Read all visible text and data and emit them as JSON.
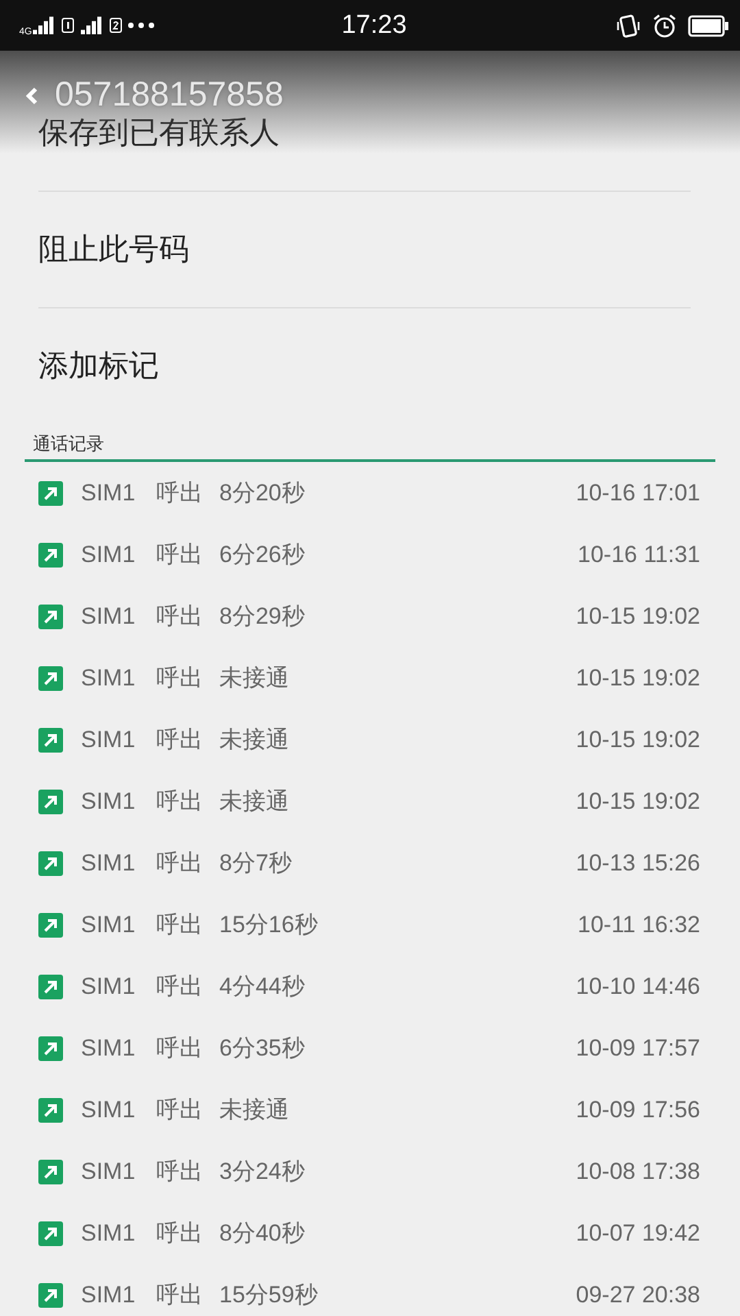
{
  "status_bar": {
    "network": "4G",
    "time": "17:23"
  },
  "header": {
    "title": "057188157858"
  },
  "actions": [
    "保存到已有联系人",
    "阻止此号码",
    "添加标记"
  ],
  "call_log": {
    "title": "通话记录",
    "rows": [
      {
        "sim": "SIM1",
        "direction": "呼出",
        "duration": "8分20秒",
        "time": "10-16 17:01"
      },
      {
        "sim": "SIM1",
        "direction": "呼出",
        "duration": "6分26秒",
        "time": "10-16 11:31"
      },
      {
        "sim": "SIM1",
        "direction": "呼出",
        "duration": "8分29秒",
        "time": "10-15 19:02"
      },
      {
        "sim": "SIM1",
        "direction": "呼出",
        "duration": "未接通",
        "time": "10-15 19:02"
      },
      {
        "sim": "SIM1",
        "direction": "呼出",
        "duration": "未接通",
        "time": "10-15 19:02"
      },
      {
        "sim": "SIM1",
        "direction": "呼出",
        "duration": "未接通",
        "time": "10-15 19:02"
      },
      {
        "sim": "SIM1",
        "direction": "呼出",
        "duration": "8分7秒",
        "time": "10-13 15:26"
      },
      {
        "sim": "SIM1",
        "direction": "呼出",
        "duration": "15分16秒",
        "time": "10-11 16:32"
      },
      {
        "sim": "SIM1",
        "direction": "呼出",
        "duration": "4分44秒",
        "time": "10-10 14:46"
      },
      {
        "sim": "SIM1",
        "direction": "呼出",
        "duration": "6分35秒",
        "time": "10-09 17:57"
      },
      {
        "sim": "SIM1",
        "direction": "呼出",
        "duration": "未接通",
        "time": "10-09 17:56"
      },
      {
        "sim": "SIM1",
        "direction": "呼出",
        "duration": "3分24秒",
        "time": "10-08 17:38"
      },
      {
        "sim": "SIM1",
        "direction": "呼出",
        "duration": "8分40秒",
        "time": "10-07 19:42"
      },
      {
        "sim": "SIM1",
        "direction": "呼出",
        "duration": "15分59秒",
        "time": "09-27 20:38"
      }
    ]
  }
}
